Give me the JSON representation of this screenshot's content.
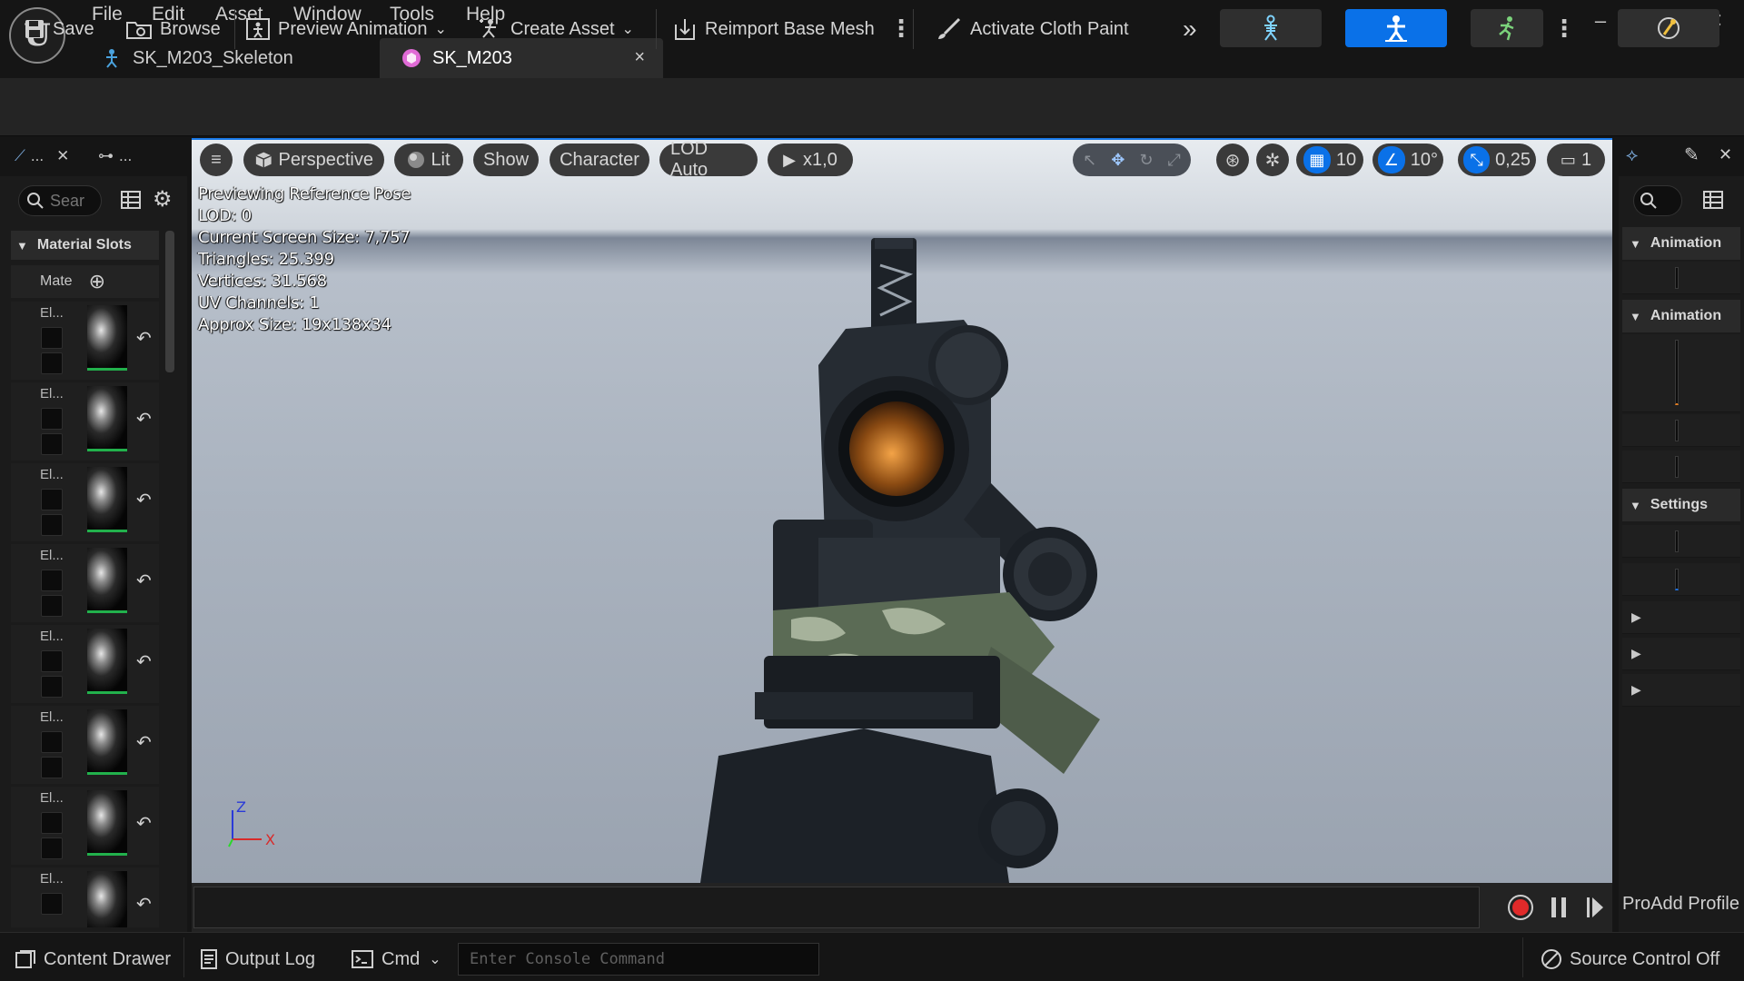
{
  "menu": [
    "File",
    "Edit",
    "Asset",
    "Window",
    "Tools",
    "Help"
  ],
  "tabs": [
    {
      "label": "SK_M203_Skeleton",
      "icon": "skeleton-icon"
    },
    {
      "label": "SK_M203",
      "icon": "skeletal-mesh-icon",
      "close": "×"
    }
  ],
  "toolbar": {
    "save": "Save",
    "browse": "Browse",
    "preview_animation": "Preview Animation",
    "create_asset": "Create Asset",
    "reimport": "Reimport Base Mesh",
    "cloth_paint": "Activate Cloth Paint"
  },
  "left_panel": {
    "tab1": "...",
    "tab2": "...",
    "search_placeholder": "Sear",
    "section": "Material Slots",
    "mat_label": "Mate",
    "slots": [
      "El...",
      "El...",
      "El...",
      "El...",
      "El...",
      "El...",
      "El...",
      "El..."
    ]
  },
  "viewport": {
    "perspective": "Perspective",
    "lit": "Lit",
    "show": "Show",
    "character": "Character",
    "lod": "LOD Auto",
    "speed": "x1,0",
    "grid_snap": "10",
    "rot_snap": "10°",
    "scale_snap": "0,25",
    "camera_speed": "1",
    "info": [
      "Previewing Reference Pose",
      "LOD: 0",
      "Current Screen Size: 7,757",
      "Triangles: 25.399",
      "Vertices: 31.568",
      "UV Channels: 1",
      "Approx Size: 19x138x34"
    ],
    "axis_z": "Z",
    "axis_x": "X"
  },
  "right_panel": {
    "section1": "Animation",
    "section2": "Animation",
    "section3": "Settings",
    "footer": "ProAdd Profile"
  },
  "statusbar": {
    "content_drawer": "Content Drawer",
    "output_log": "Output Log",
    "cmd": "Cmd",
    "console_placeholder": "Enter Console Command",
    "source_control": "Source Control Off"
  },
  "colors": {
    "accent": "#0a71e8",
    "panel": "#1b1b1b",
    "titlebar": "#151515"
  }
}
